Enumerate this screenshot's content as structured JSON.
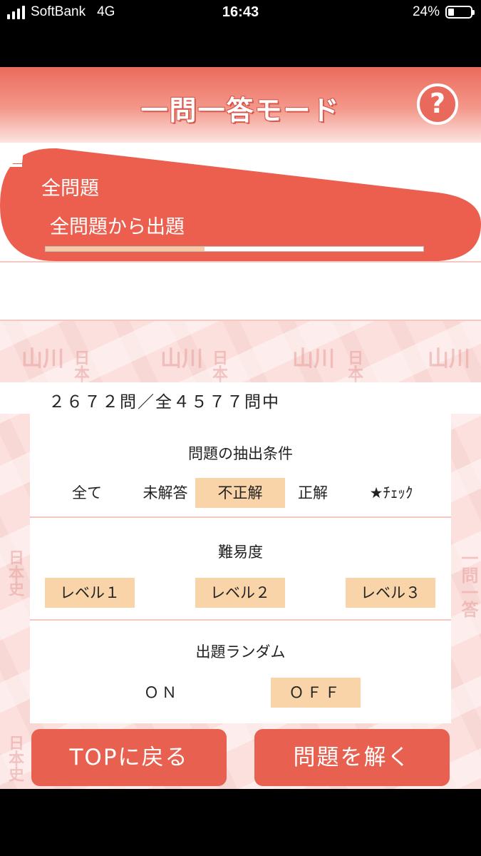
{
  "status_bar": {
    "carrier": "SoftBank",
    "network": "4G",
    "time": "16:43",
    "battery": "24%"
  },
  "header": {
    "title": "一問一答モード",
    "help_label": "?"
  },
  "category": {
    "name": "全問題",
    "description": "全問題から出題",
    "progress_fraction": 0.42
  },
  "watermark": {
    "publisher": "山川",
    "subject": "日本史",
    "mode": "一問一答"
  },
  "count_text": "２６７２問／全４５７７問中",
  "filter": {
    "title": "問題の抽出条件",
    "options": [
      "全て",
      "未解答",
      "不正解",
      "正解",
      "★ﾁｪｯｸ"
    ],
    "selected": "不正解"
  },
  "difficulty": {
    "title": "難易度",
    "options": [
      "レベル１",
      "レベル２",
      "レベル３"
    ],
    "selected": [
      "レベル１",
      "レベル２",
      "レベル３"
    ]
  },
  "random": {
    "title": "出題ランダム",
    "options": [
      "ＯＮ",
      "ＯＦＦ"
    ],
    "selected": "ＯＦＦ"
  },
  "buttons": {
    "back": "TOPに戻る",
    "start": "問題を解く"
  },
  "colors": {
    "accent": "#e8604f",
    "selected": "#f8d4a8",
    "pattern": "#fbe0de"
  }
}
